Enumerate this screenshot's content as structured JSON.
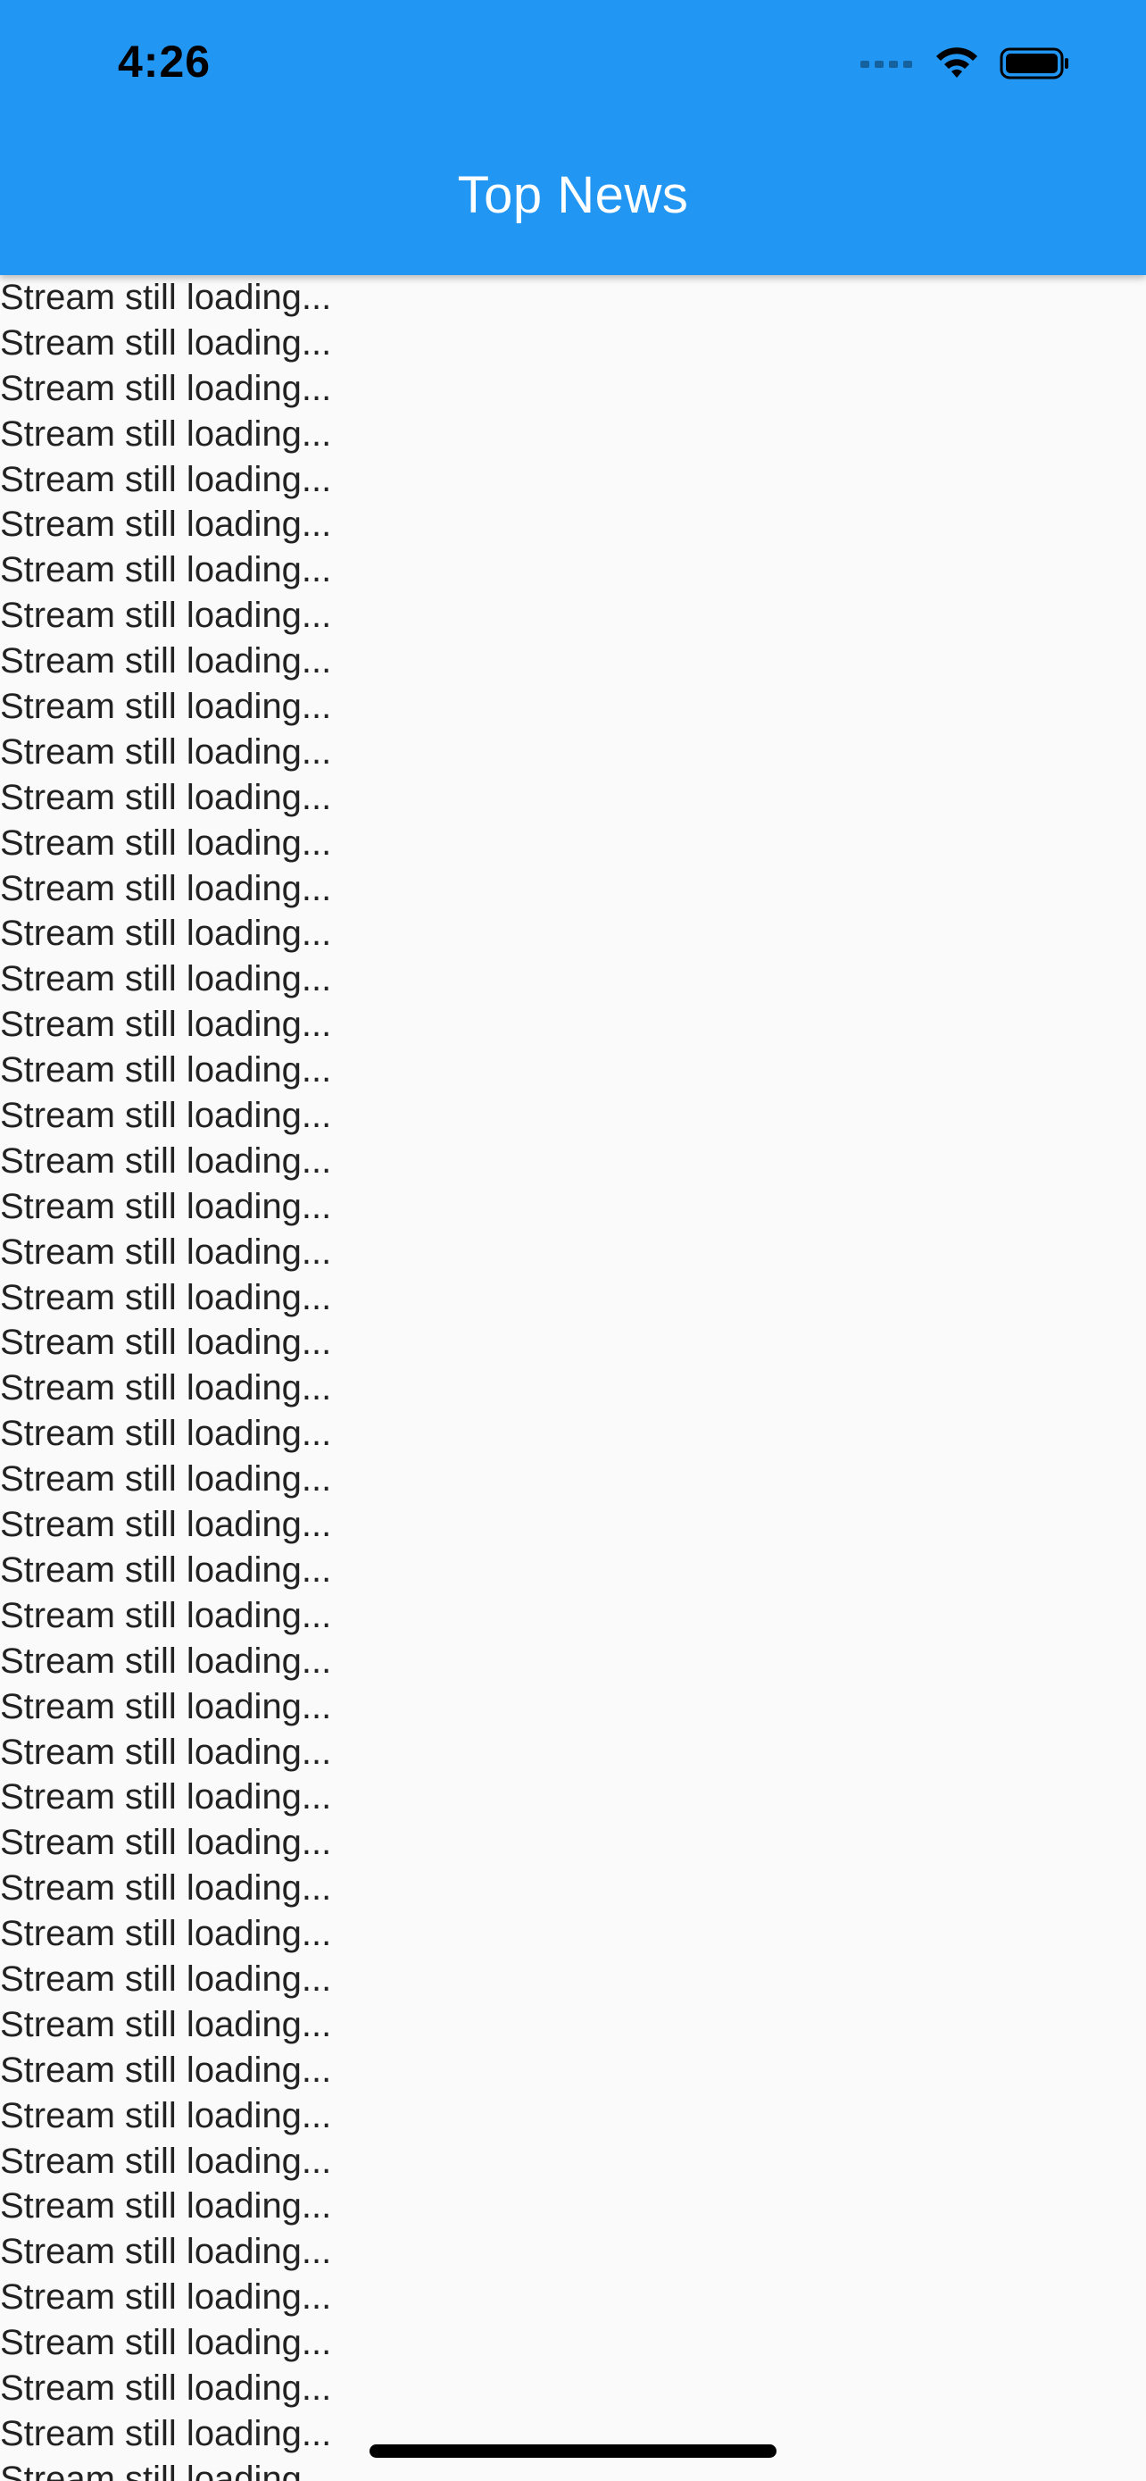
{
  "status_bar": {
    "time": "4:26"
  },
  "app_bar": {
    "title": "Top News",
    "color": "#2196f3"
  },
  "list": {
    "item_text": "Stream still loading...",
    "visible_items": 49
  }
}
